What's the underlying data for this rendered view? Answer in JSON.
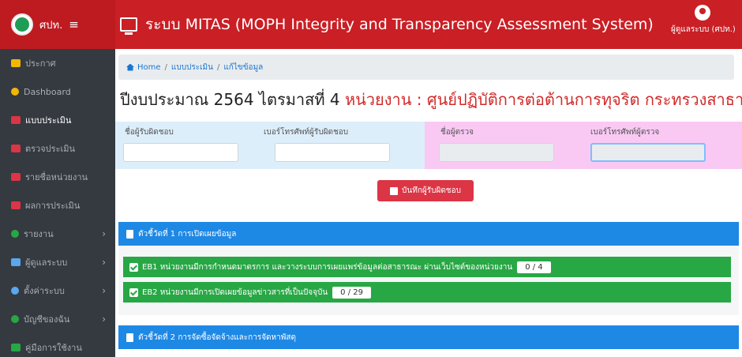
{
  "header": {
    "brand": "ศปท.",
    "title": "ระบบ MITAS (MOPH Integrity and Transparency Assessment System)",
    "user_label": "ผู้ดูแลระบบ (ศปท.)"
  },
  "sidebar": {
    "items": [
      {
        "label": "ประกาศ"
      },
      {
        "label": "Dashboard"
      },
      {
        "label": "แบบประเมิน"
      },
      {
        "label": "ตรวจประเมิน"
      },
      {
        "label": "รายชื่อหน่วยงาน"
      },
      {
        "label": "ผลการประเมิน"
      },
      {
        "label": "รายงาน"
      },
      {
        "label": "ผู้ดูแลระบบ"
      },
      {
        "label": "ตั้งค่าระบบ"
      },
      {
        "label": "บัญชีของฉัน"
      },
      {
        "label": "คู่มือการใช้งาน"
      }
    ]
  },
  "breadcrumb": {
    "home": "Home",
    "level2": "แบบประเมิน",
    "level3": "แก้ไขข้อมูล"
  },
  "heading": {
    "period": "ปีงบประมาณ 2564 ไตรมาสที่ 4",
    "unit": "หน่วยงาน : ศูนย์ปฏิบัติการต่อต้านการทุจริต กระทรวงสาธารณสุข"
  },
  "form": {
    "responsible_name_label": "ชื่อผู้รับผิดชอบ",
    "responsible_phone_label": "เบอร์โทรศัพท์ผู้รับผิดชอบ",
    "inspector_name_label": "ชื่อผู้ตรวจ",
    "inspector_phone_label": "เบอร์โทรศัพท์ผู้ตรวจ",
    "save_label": "บันทึกผู้รับผิดชอบ"
  },
  "indicators": [
    {
      "title": "ตัวชี้วัดที่ 1 การเปิดเผยข้อมูล",
      "items": [
        {
          "label": "EB1 หน่วยงานมีการกำหนดมาตรการ และวางระบบการเผยแพร่ข้อมูลต่อสาธารณะ ผ่านเว็บไซต์ของหน่วยงาน",
          "score": "0 / 4"
        },
        {
          "label": "EB2 หน่วยงานมีการเปิดเผยข้อมูลข่าวสารที่เป็นปัจจุบัน",
          "score": "0 / 29"
        }
      ]
    },
    {
      "title": "ตัวชี้วัดที่ 2 การจัดซื้อจัดจ้างและการจัดหาพัสดุ"
    }
  ]
}
